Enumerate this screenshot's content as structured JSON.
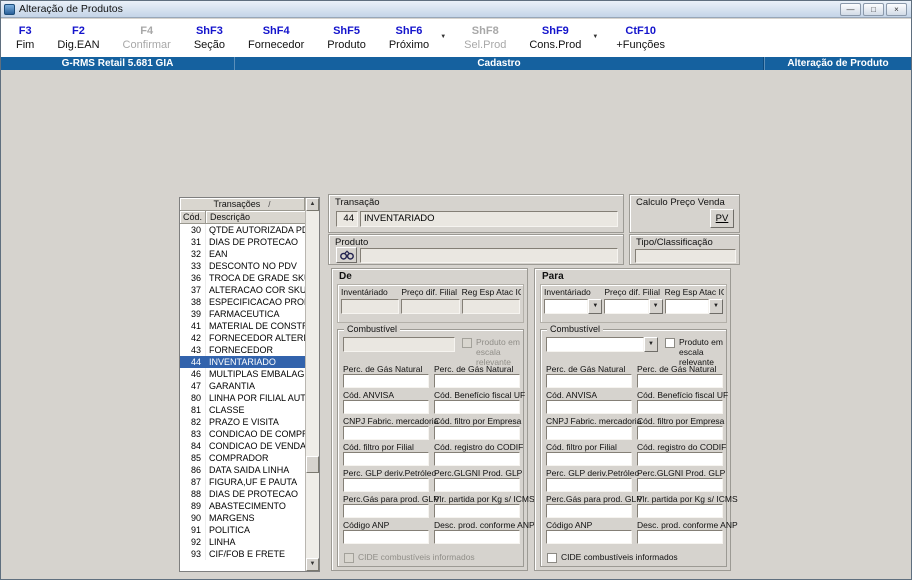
{
  "window": {
    "title": "Alteração de Produtos"
  },
  "icons": {
    "minimize": "—",
    "maximize": "□",
    "close": "×",
    "dropdown": "▼",
    "sort": "/",
    "arrow_up": "▲",
    "arrow_down": "▼"
  },
  "toolbar": {
    "buttons": [
      {
        "key": "F3",
        "label": "Fim",
        "enabled": true,
        "dropdown": false
      },
      {
        "key": "F2",
        "label": "Dig.EAN",
        "enabled": true,
        "dropdown": false
      },
      {
        "key": "F4",
        "label": "Confirmar",
        "enabled": false,
        "dropdown": false
      },
      {
        "key": "ShF3",
        "label": "Seção",
        "enabled": true,
        "dropdown": false
      },
      {
        "key": "ShF4",
        "label": "Fornecedor",
        "enabled": true,
        "dropdown": false
      },
      {
        "key": "ShF5",
        "label": "Produto",
        "enabled": true,
        "dropdown": false
      },
      {
        "key": "ShF6",
        "label": "Próximo",
        "enabled": true,
        "dropdown": true
      },
      {
        "key": "ShF8",
        "label": "Sel.Prod",
        "enabled": false,
        "dropdown": false
      },
      {
        "key": "ShF9",
        "label": "Cons.Prod",
        "enabled": true,
        "dropdown": true
      },
      {
        "key": "CtF10",
        "label": "+Funções",
        "enabled": true,
        "dropdown": false
      }
    ]
  },
  "banner": {
    "left": "G-RMS Retail 5.681 GIA",
    "center": "Cadastro",
    "right": "Alteração de Produto"
  },
  "transactions": {
    "header": "Transações",
    "columns": {
      "code": "Cód.",
      "desc": "Descrição"
    },
    "rows": [
      {
        "code": "30",
        "desc": "QTDE AUTORIZADA PDV",
        "selected": false
      },
      {
        "code": "31",
        "desc": "DIAS DE PROTECAO",
        "selected": false
      },
      {
        "code": "32",
        "desc": "EAN",
        "selected": false
      },
      {
        "code": "33",
        "desc": "DESCONTO NO PDV",
        "selected": false
      },
      {
        "code": "36",
        "desc": "TROCA DE GRADE SKU",
        "selected": false
      },
      {
        "code": "37",
        "desc": "ALTERACAO COR SKU",
        "selected": false
      },
      {
        "code": "38",
        "desc": "ESPECIFICACAO PRODUTO",
        "selected": false
      },
      {
        "code": "39",
        "desc": "FARMACEUTICA",
        "selected": false
      },
      {
        "code": "41",
        "desc": "MATERIAL DE CONSTRUCA",
        "selected": false
      },
      {
        "code": "42",
        "desc": "FORNECEDOR ALTERNATIV",
        "selected": false
      },
      {
        "code": "43",
        "desc": "FORNECEDOR",
        "selected": false
      },
      {
        "code": "44",
        "desc": "INVENTARIADO",
        "selected": true
      },
      {
        "code": "46",
        "desc": "MULTIPLAS EMBALAGEN",
        "selected": false
      },
      {
        "code": "47",
        "desc": "GARANTIA",
        "selected": false
      },
      {
        "code": "80",
        "desc": "LINHA POR FILIAL AUTO",
        "selected": false
      },
      {
        "code": "81",
        "desc": "CLASSE",
        "selected": false
      },
      {
        "code": "82",
        "desc": "PRAZO E VISITA",
        "selected": false
      },
      {
        "code": "83",
        "desc": "CONDICAO DE COMPRA",
        "selected": false
      },
      {
        "code": "84",
        "desc": "CONDICAO DE VENDA",
        "selected": false
      },
      {
        "code": "85",
        "desc": "COMPRADOR",
        "selected": false
      },
      {
        "code": "86",
        "desc": "DATA SAIDA LINHA",
        "selected": false
      },
      {
        "code": "87",
        "desc": "FIGURA,UF E PAUTA",
        "selected": false
      },
      {
        "code": "88",
        "desc": "DIAS DE PROTECAO",
        "selected": false
      },
      {
        "code": "89",
        "desc": "ABASTECIMENTO",
        "selected": false
      },
      {
        "code": "90",
        "desc": "MARGENS",
        "selected": false
      },
      {
        "code": "91",
        "desc": "POLITICA",
        "selected": false
      },
      {
        "code": "92",
        "desc": "LINHA",
        "selected": false
      },
      {
        "code": "93",
        "desc": "CIF/FOB E FRETE",
        "selected": false
      }
    ]
  },
  "form": {
    "transacao": {
      "label": "Transação",
      "code": "44",
      "name": "INVENTARIADO"
    },
    "calculo_preco": {
      "label": "Calculo Preço Venda",
      "button": "PV"
    },
    "produto": {
      "label": "Produto",
      "value": ""
    },
    "tipo_classificacao": {
      "label": "Tipo/Classificação",
      "value": ""
    },
    "panels": {
      "de": {
        "title": "De"
      },
      "para": {
        "title": "Para"
      }
    },
    "top_fields": [
      "Inventáriado",
      "Preço dif. Filial",
      "Reg Esp Atac ICMS"
    ],
    "fuel": {
      "group_label": "Combustível",
      "escala_checkbox": "Produto em escala relevante",
      "cide_checkbox": "CIDE combustíveis informados",
      "rows": [
        {
          "left": "Perc. de  Gás Natural",
          "right": "Perc. de  Gás Natural"
        },
        {
          "left": "Cód. ANVISA",
          "right": "Cód. Benefício fiscal UF"
        },
        {
          "left": "CNPJ Fabric. mercadoria",
          "right": "Cód. filtro por Empresa"
        },
        {
          "left": "Cód. filtro por Filial",
          "right": "Cód. registro do CODIF"
        },
        {
          "left": "Perc. GLP deriv.Petróleo",
          "right": "Perc.GLGNI Prod. GLP"
        },
        {
          "left": "Perc.Gás para prod. GLP",
          "right": "Vlr. partida por Kg s/ ICMS"
        },
        {
          "left": "Código ANP",
          "right": "Desc. prod. conforme ANP"
        }
      ]
    }
  },
  "colors": {
    "banner_blue": "#15619f",
    "selection_blue": "#3263ac",
    "hotkey_blue": "#1414cc"
  }
}
